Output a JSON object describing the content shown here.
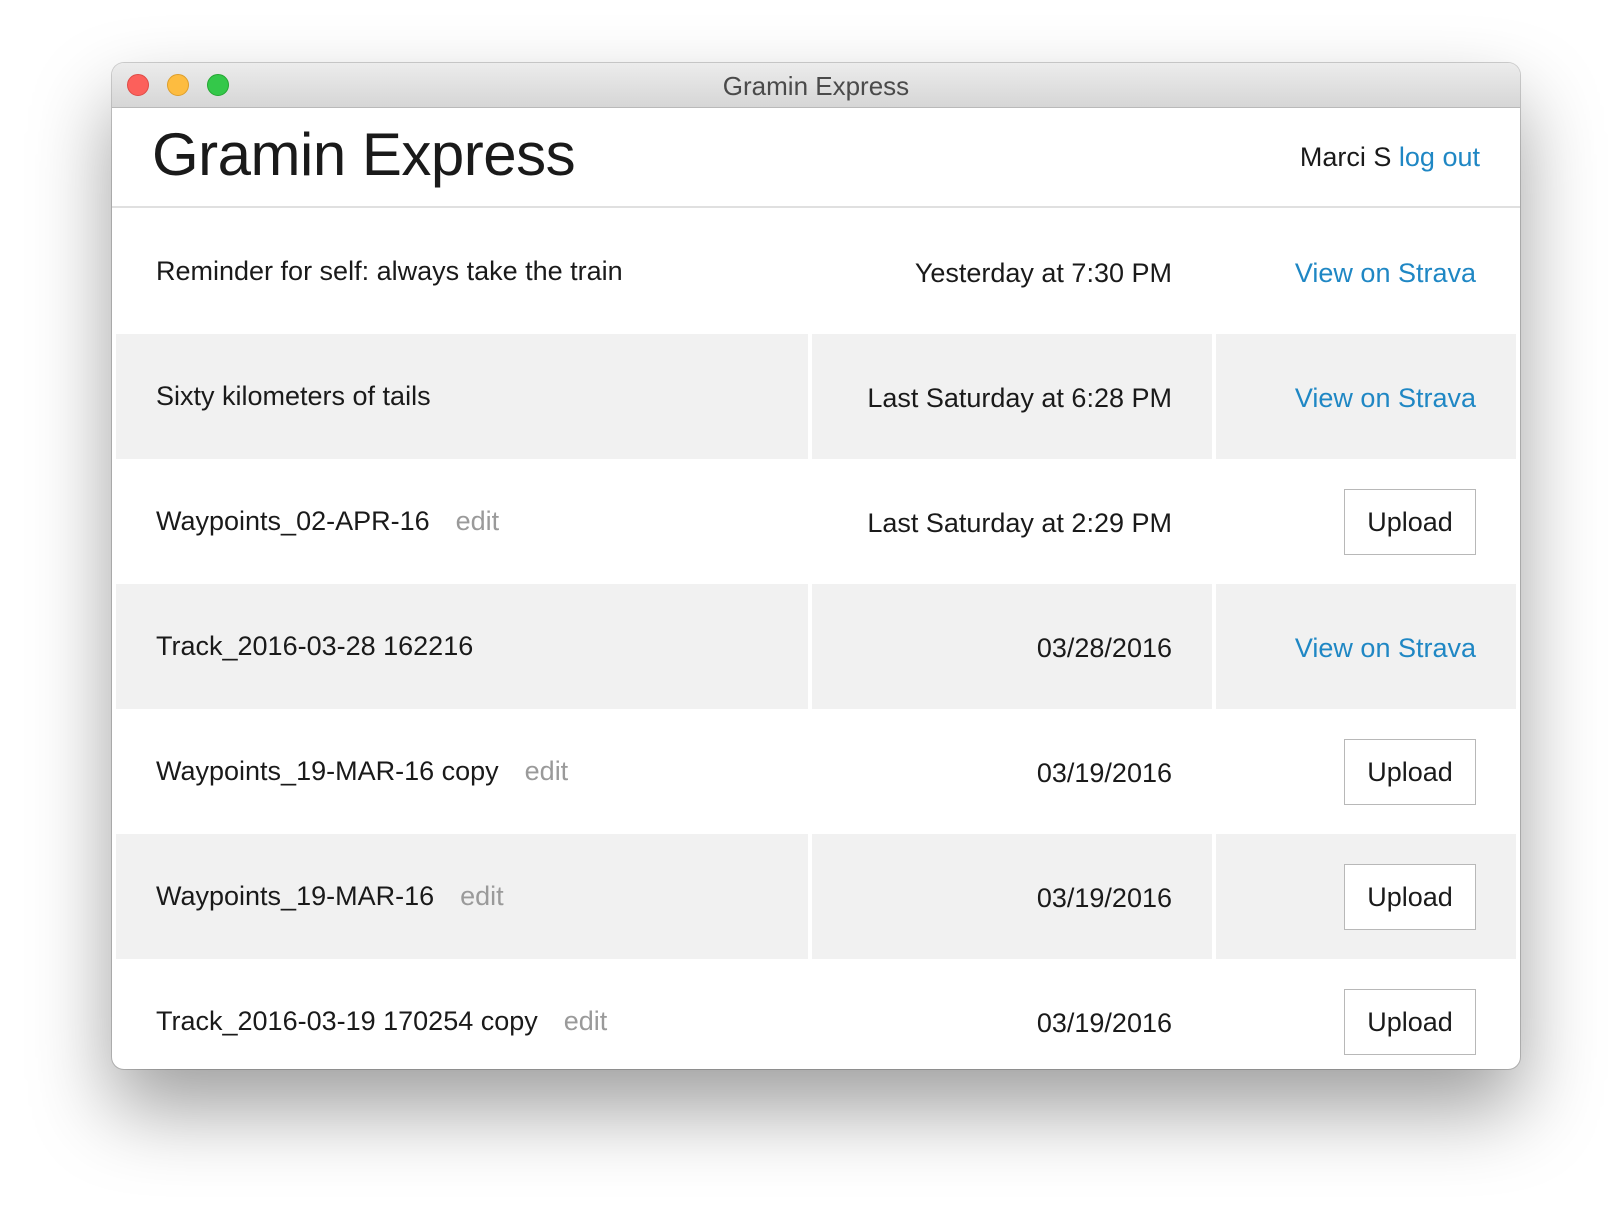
{
  "window": {
    "title": "Gramin Express"
  },
  "header": {
    "app_title": "Gramin Express",
    "user_name": "Marci S",
    "logout_label": "log out"
  },
  "rows": [
    {
      "name": "Reminder for self: always take the train",
      "date": "Yesterday at 7:30 PM",
      "action": "View on Strava",
      "edit": ""
    },
    {
      "name": "Sixty kilometers of tails",
      "date": "Last Saturday at 6:28 PM",
      "action": "View on Strava",
      "edit": ""
    },
    {
      "name": "Waypoints_02-APR-16",
      "date": "Last Saturday at 2:29 PM",
      "action": "Upload",
      "edit": "edit"
    },
    {
      "name": "Track_2016-03-28 162216",
      "date": "03/28/2016",
      "action": "View on Strava",
      "edit": ""
    },
    {
      "name": "Waypoints_19-MAR-16 copy",
      "date": "03/19/2016",
      "action": "Upload",
      "edit": "edit"
    },
    {
      "name": "Waypoints_19-MAR-16",
      "date": "03/19/2016",
      "action": "Upload",
      "edit": "edit"
    },
    {
      "name": "Track_2016-03-19 170254 copy",
      "date": "03/19/2016",
      "action": "Upload",
      "edit": "edit"
    }
  ],
  "colors": {
    "link": "#1f87c4",
    "edit": "#9a9a9a",
    "row_shade": "#f1f1f1"
  }
}
